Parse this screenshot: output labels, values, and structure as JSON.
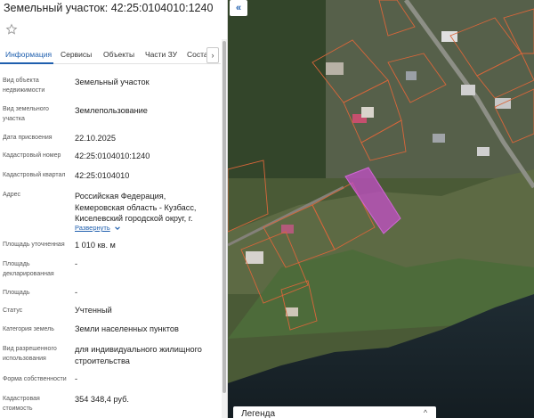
{
  "panel": {
    "title": "Земельный участок: 42:25:0104010:1240",
    "tabs": [
      {
        "label": "Информация"
      },
      {
        "label": "Сервисы"
      },
      {
        "label": "Объекты"
      },
      {
        "label": "Части ЗУ"
      },
      {
        "label": "Состав"
      }
    ],
    "tab_next": "›",
    "fields": [
      {
        "label": "Вид объекта недвижимости",
        "value": "Земельный участок"
      },
      {
        "label": "Вид земельного участка",
        "value": "Землепользование"
      },
      {
        "label": "Дата присвоения",
        "value": "22.10.2025"
      },
      {
        "label": "Кадастровый номер",
        "value": "42:25:0104010:1240"
      },
      {
        "label": "Кадастровый квартал",
        "value": "42:25:0104010"
      },
      {
        "label": "Адрес",
        "value": "Российская Федерация, Кемеровская область - Кузбасс, Киселевский городской округ, г."
      },
      {
        "label": "Площадь уточненная",
        "value": "1 010 кв. м"
      },
      {
        "label": "Площадь декларированная",
        "value": "-"
      },
      {
        "label": "Площадь",
        "value": "-"
      },
      {
        "label": "Статус",
        "value": "Учтенный"
      },
      {
        "label": "Категория земель",
        "value": "Земли населенных пунктов"
      },
      {
        "label": "Вид разрешенного использования",
        "value": "для индивидуального жилищного строительства"
      },
      {
        "label": "Форма собственности",
        "value": "-"
      },
      {
        "label": "Кадастровая стоимость",
        "value": "354 348,4 руб."
      }
    ],
    "expand_link": "Развернуть"
  },
  "map": {
    "collapse_button": "«",
    "legend_title": "Легенда",
    "legend_toggle": "^",
    "selected_parcel_color": "#c44fc8",
    "parcel_border_color": "#d9663a"
  }
}
